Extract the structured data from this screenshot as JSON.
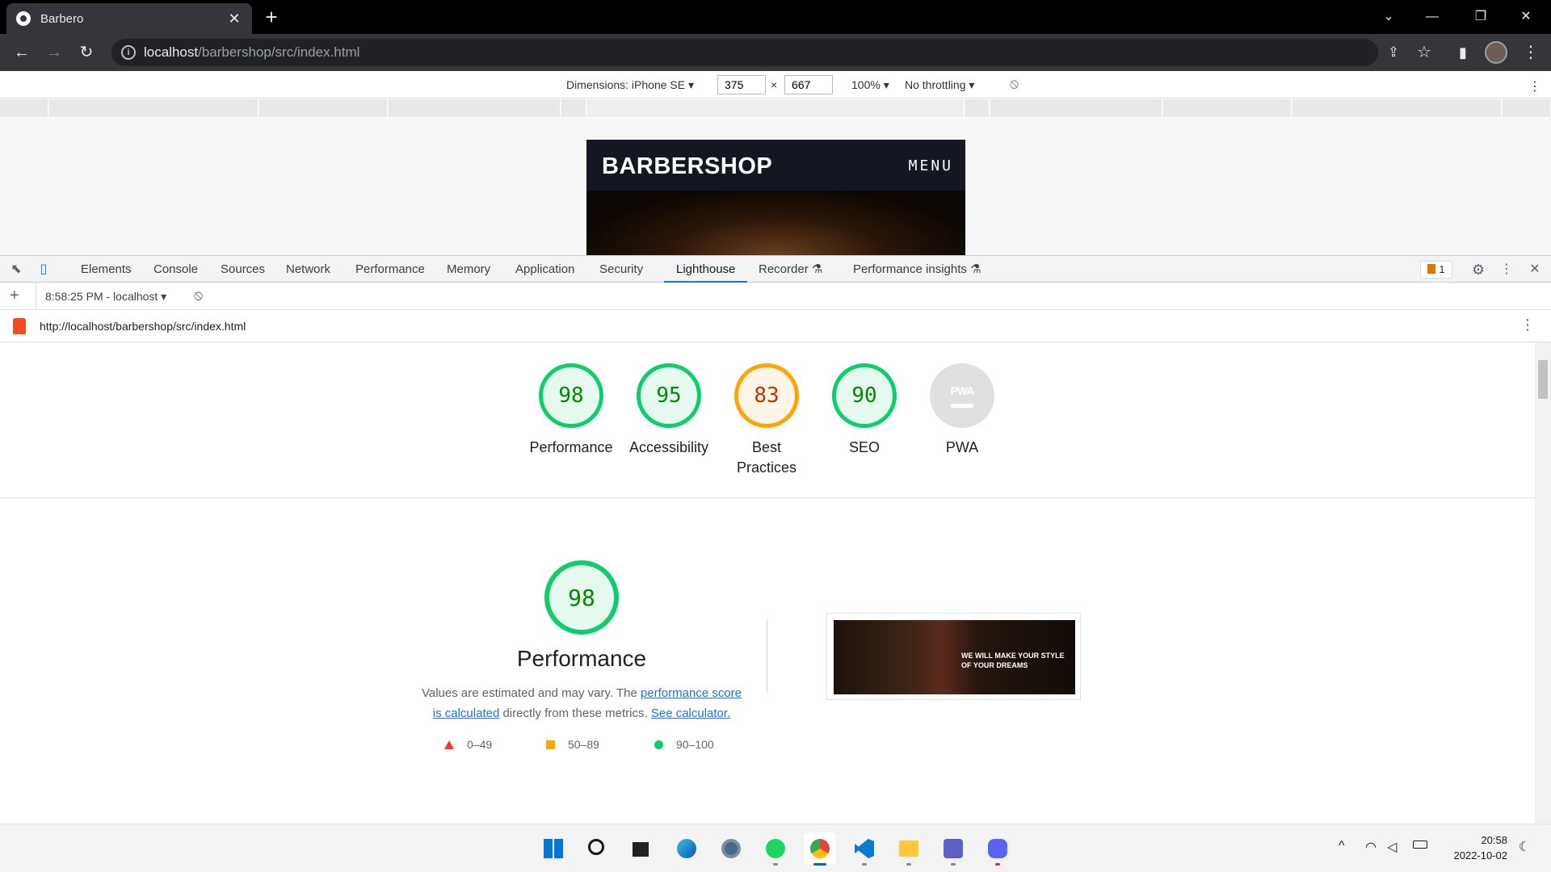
{
  "browser": {
    "tab_title": "Barbero",
    "url_host": "localhost",
    "url_path": "/barbershop/src/index.html"
  },
  "device_toolbar": {
    "dimensions_label": "Dimensions: iPhone SE",
    "width": "375",
    "times": "×",
    "height": "667",
    "zoom": "100%",
    "throttling": "No throttling"
  },
  "site_preview": {
    "logo": "BARBERSHOP",
    "menu": "MENU"
  },
  "devtools": {
    "tabs": [
      "Elements",
      "Console",
      "Sources",
      "Network",
      "Performance",
      "Memory",
      "Application",
      "Security",
      "Lighthouse",
      "Recorder",
      "Performance insights"
    ],
    "active_tab": "Lighthouse",
    "issues_count": "1",
    "report_selector": "8:58:25 PM - localhost",
    "report_url": "http://localhost/barbershop/src/index.html"
  },
  "scores": [
    {
      "label": "Performance",
      "value": "98",
      "status": "pass"
    },
    {
      "label": "Accessibility",
      "value": "95",
      "status": "pass"
    },
    {
      "label": "Best Practices",
      "value": "83",
      "status": "average"
    },
    {
      "label": "SEO",
      "value": "90",
      "status": "pass"
    },
    {
      "label": "PWA",
      "value": "",
      "status": "na",
      "badge": "PWA"
    }
  ],
  "performance_section": {
    "score": "98",
    "title": "Performance",
    "desc_prefix": "Values are estimated and may vary. The ",
    "link1": "performance score is calculated",
    "desc_middle": " directly from these metrics. ",
    "link2": "See calculator.",
    "legend": [
      {
        "range": "0–49",
        "shape": "triangle",
        "color": "#ff3333"
      },
      {
        "range": "50–89",
        "shape": "square",
        "color": "#ffa400"
      },
      {
        "range": "90–100",
        "shape": "circle",
        "color": "#0cce6b"
      }
    ],
    "screenshot_text": "WE WILL MAKE YOUR STYLE OF YOUR DREAMS"
  },
  "taskbar": {
    "apps": [
      "start-icon",
      "search-icon",
      "task-view-icon",
      "edge-icon",
      "settings-icon",
      "spotify-icon",
      "chrome-icon",
      "vscode-icon",
      "file-explorer-icon",
      "teams-icon",
      "discord-icon"
    ],
    "time": "20:58",
    "date": "2022-10-02"
  },
  "colors": {
    "pass": "#0cce6b",
    "average": "#ffa400",
    "fail": "#ff3333",
    "accent": "#1a73e8"
  }
}
